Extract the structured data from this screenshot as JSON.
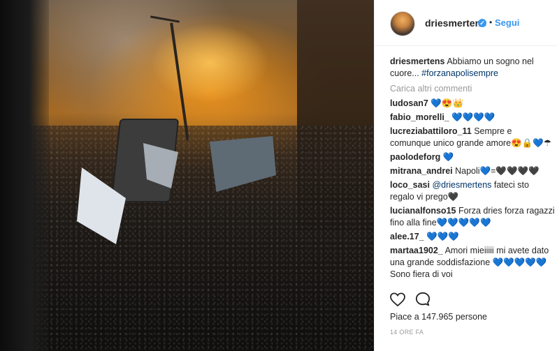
{
  "post": {
    "username": "driesmertens",
    "follow_label": "Segui",
    "dot": "•",
    "verified_mark": "✓",
    "caption_user": "driesmertens",
    "caption_text": "Abbiamo un sogno nel cuore... ",
    "caption_hashtag": "#forzanapolisempre",
    "load_more": "Carica altri commenti",
    "likes_text": "Piace a 147.965 persone",
    "time_ago": "14 ORE FA"
  },
  "comments": [
    {
      "user": "ludosan7",
      "text": "💙😍👑"
    },
    {
      "user": "fabio_morelli_",
      "text": "💙💙💙💙"
    },
    {
      "user": "lucreziabattiloro_11",
      "text": "Sempre e comunque unico grande amore😍🔒💙☂"
    },
    {
      "user": "paolodeforg",
      "text": "💙"
    },
    {
      "user": "mitrana_andrei",
      "text": "Napoli💙=🖤🖤🖤🖤"
    },
    {
      "user": "loco_sasi",
      "mention": "@driesmertens",
      "text": " fateci sto regalo vi prego🖤"
    },
    {
      "user": "lucianalfonso15",
      "text": "Forza dries forza ragazzi fino alla fine💙💙💙💙💙"
    },
    {
      "user": "alee.17_",
      "text": "💙💙💙"
    },
    {
      "user": "martaa1902_",
      "text": "Amori mieiiiii mi avete dato una grande soddisfazione 💙💙💙💙💙 Sono fiera di voi"
    }
  ],
  "icons": {
    "like": "heart-outline-icon",
    "comment": "comment-bubble-icon"
  },
  "colors": {
    "accent": "#3897f0",
    "text": "#262626",
    "muted": "#999999",
    "mention": "#003569"
  }
}
